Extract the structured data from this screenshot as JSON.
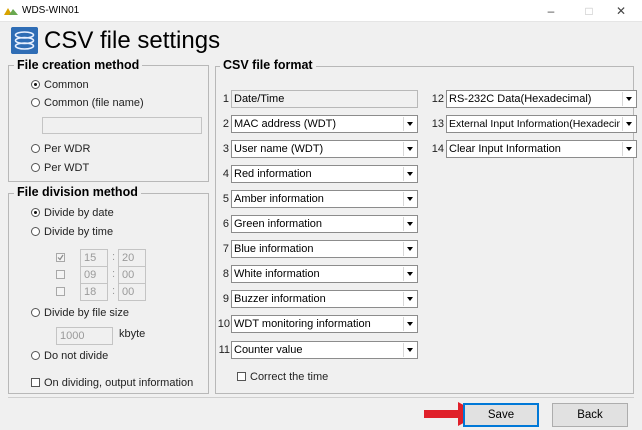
{
  "window": {
    "title": "WDS-WIN01",
    "minimize": "–",
    "maximize": "□",
    "close": "✕"
  },
  "header": {
    "title": "CSV file settings",
    "icon": "csv-settings-icon"
  },
  "creation": {
    "legend": "File creation method",
    "options": [
      "Common",
      "Common (file name)",
      "Per WDR",
      "Per WDT"
    ],
    "selected": "Common",
    "file_name_value": ""
  },
  "division": {
    "legend": "File division method",
    "by_date": "Divide by date",
    "by_time": "Divide by time",
    "times": [
      {
        "checked": true,
        "hour": "15",
        "minute": "20"
      },
      {
        "checked": false,
        "hour": "09",
        "minute": "00"
      },
      {
        "checked": false,
        "hour": "18",
        "minute": "00"
      }
    ],
    "colon": ":",
    "by_size": "Divide by file size",
    "size_value": "1000",
    "size_unit": "kbyte",
    "no_divide": "Do not divide",
    "selected": "Divide by date",
    "output_info_label": "On dividing, output information",
    "output_info_checked": false
  },
  "format": {
    "legend": "CSV file format",
    "fields": [
      {
        "num": "1",
        "value": "Date/Time",
        "readonly": true
      },
      {
        "num": "2",
        "value": "MAC address (WDT)"
      },
      {
        "num": "3",
        "value": "User name (WDT)"
      },
      {
        "num": "4",
        "value": "Red information"
      },
      {
        "num": "5",
        "value": "Amber information"
      },
      {
        "num": "6",
        "value": "Green information"
      },
      {
        "num": "7",
        "value": "Blue information"
      },
      {
        "num": "8",
        "value": "White information"
      },
      {
        "num": "9",
        "value": "Buzzer information"
      },
      {
        "num": "10",
        "value": "WDT monitoring information"
      },
      {
        "num": "11",
        "value": "Counter value"
      },
      {
        "num": "12",
        "value": "RS-232C Data(Hexadecimal)"
      },
      {
        "num": "13",
        "value": "External Input Information(Hexadecimal)"
      },
      {
        "num": "14",
        "value": "Clear Input Information"
      }
    ],
    "correct_time_label": "Correct the time",
    "correct_time_checked": false
  },
  "buttons": {
    "save": "Save",
    "back": "Back"
  },
  "colors": {
    "accent": "#0078d7",
    "arrow": "#e0202a",
    "icon": "#2f6db5"
  }
}
